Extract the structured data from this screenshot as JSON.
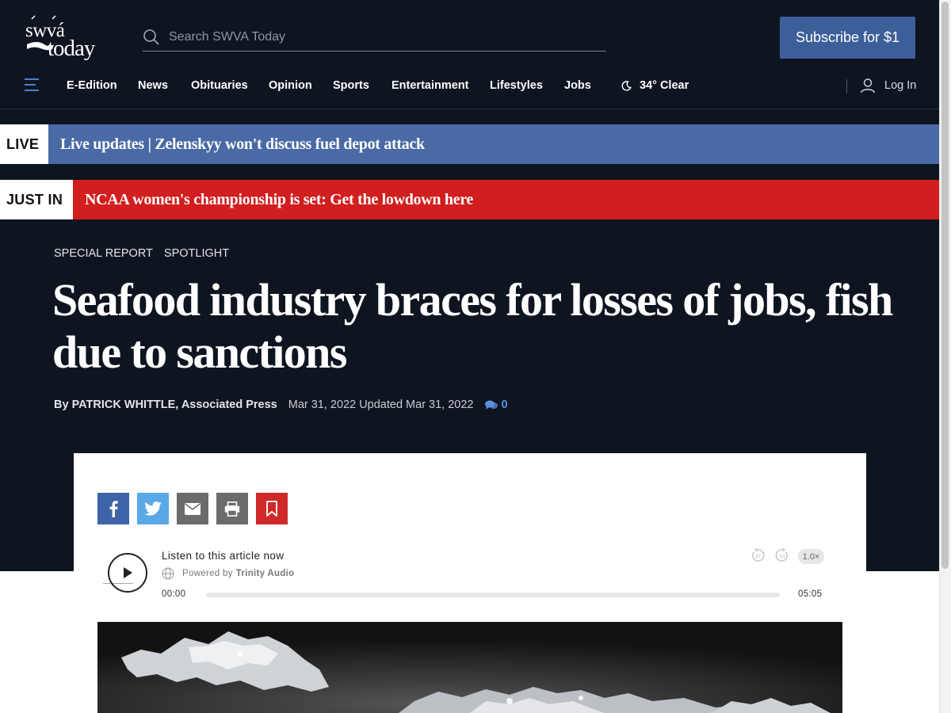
{
  "site": {
    "logo_text": "swva today",
    "search_placeholder": "Search SWVA Today",
    "subscribe_label": "Subscribe for $1"
  },
  "nav": {
    "items": [
      "E-Edition",
      "News",
      "Obituaries",
      "Opinion",
      "Sports",
      "Entertainment",
      "Lifestyles",
      "Jobs"
    ],
    "weather": "34° Clear",
    "login": "Log In"
  },
  "banners": {
    "live": {
      "tag": "LIVE",
      "text": "Live updates | Zelenskyy won't discuss fuel depot attack"
    },
    "just_in": {
      "tag": "JUST IN",
      "text": "NCAA women's championship is set: Get the lowdown here"
    }
  },
  "article": {
    "kickers": [
      "SPECIAL REPORT",
      "SPOTLIGHT"
    ],
    "headline": "Seafood industry braces for losses of jobs, fish due to sanctions",
    "byline": "By PATRICK WHITTLE, Associated Press",
    "date": "Mar 31, 2022 Updated Mar 31, 2022",
    "comment_count": "0"
  },
  "share": [
    "facebook-icon",
    "twitter-icon",
    "email-icon",
    "print-icon",
    "bookmark-icon"
  ],
  "audio": {
    "title": "Listen to this article now",
    "powered_by": "Powered by",
    "brand": "Trinity Audio",
    "speed": "1.0×",
    "time_current": "00:00",
    "time_total": "05:05",
    "progress": 0
  },
  "colors": {
    "header_bg": "#0f1520",
    "subscribe": "#3d5f99",
    "live_bar": "#4a6aa6",
    "just_in_bar": "#d11e1e",
    "accent": "#4a7fd1"
  }
}
